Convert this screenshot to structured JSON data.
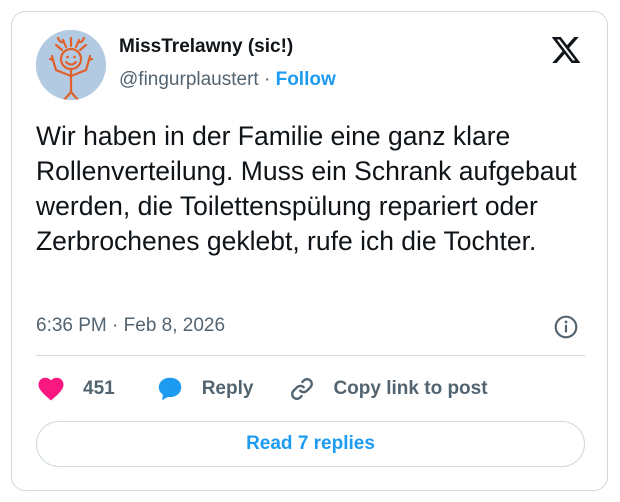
{
  "author": {
    "display_name": "MissTrelawny (sic!)",
    "handle": "@fingurplaustert",
    "separator": "·",
    "follow_label": "Follow"
  },
  "tweet": {
    "text": "Wir haben in der Familie eine ganz klare Rollenverteilung. Muss ein Schrank aufgebaut werden, die Toilettenspülung repariert oder Zerbrochenes geklebt, rufe ich die Tochter.",
    "timestamp": "6:36 PM · Feb 8, 2026"
  },
  "actions": {
    "like_count": "451",
    "reply_label": "Reply",
    "copy_link_label": "Copy link to post"
  },
  "read_replies_label": "Read 7 replies",
  "icons": {
    "brand": "x-logo-icon",
    "info": "info-icon",
    "like": "heart-icon",
    "reply": "speech-bubble-icon",
    "copy": "link-icon"
  },
  "colors": {
    "accent": "#1d9bf0",
    "like": "#f91880",
    "muted_text": "#536471",
    "border": "#cfd9de"
  }
}
